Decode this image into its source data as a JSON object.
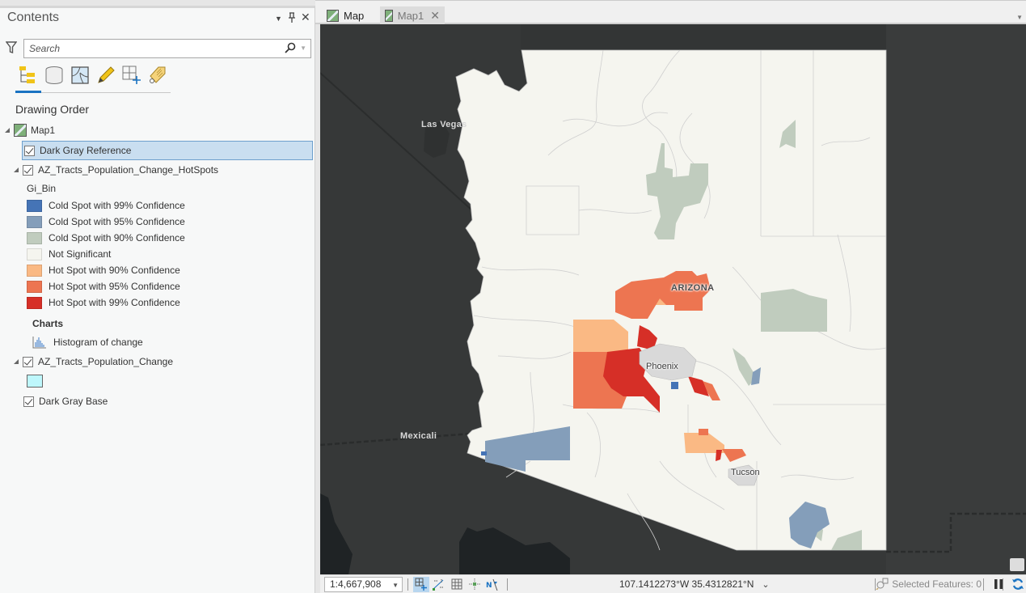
{
  "contents_pane": {
    "title": "Contents",
    "search": {
      "placeholder": "Search",
      "value": ""
    },
    "view_tabs": [
      {
        "name": "list-by-drawing-order",
        "icon": "drawing-order-icon",
        "active": true
      },
      {
        "name": "list-by-data-source",
        "icon": "data-source-icon"
      },
      {
        "name": "list-by-selection",
        "icon": "selection-icon"
      },
      {
        "name": "list-by-editing",
        "icon": "pencil-icon"
      },
      {
        "name": "list-by-snapping",
        "icon": "snapping-icon"
      },
      {
        "name": "list-by-labeling",
        "icon": "label-tag-icon"
      }
    ],
    "heading": "Drawing Order",
    "map_name": "Map1",
    "layers": {
      "reference": {
        "name": "Dark Gray Reference",
        "checked": true,
        "selected": true
      },
      "hotspots": {
        "name": "AZ_Tracts_Population_Change_HotSpots",
        "checked": true,
        "field": "Gi_Bin",
        "classes": [
          {
            "label": "Cold Spot with 99% Confidence",
            "color": "#4574b6"
          },
          {
            "label": "Cold Spot with 95% Confidence",
            "color": "#849eba"
          },
          {
            "label": "Cold Spot with 90% Confidence",
            "color": "#c0ccbe"
          },
          {
            "label": "Not Significant",
            "color": "#f5f5ef"
          },
          {
            "label": "Hot Spot with 90% Confidence",
            "color": "#fab984"
          },
          {
            "label": "Hot Spot with 95% Confidence",
            "color": "#ed7551"
          },
          {
            "label": "Hot Spot with 99% Confidence",
            "color": "#d62f27"
          }
        ],
        "charts_heading": "Charts",
        "chart": "Histogram of change"
      },
      "population_change": {
        "name": "AZ_Tracts_Population_Change",
        "checked": true,
        "color": "#bef7fc"
      },
      "base": {
        "name": "Dark Gray Base",
        "checked": true
      }
    }
  },
  "map_tabs": [
    {
      "label": "Map",
      "active": false
    },
    {
      "label": "Map1",
      "active": true,
      "closable": true
    }
  ],
  "map": {
    "colors": {
      "background": "#363838",
      "land": "#f5f5ef",
      "water_dark": "#1f2325",
      "boundary": "#c8c8c8"
    },
    "labels": {
      "las_vegas": "Las Vegas",
      "mexicali": "Mexicali",
      "arizona": "ARIZONA",
      "phoenix": "Phoenix",
      "tucson": "Tucson"
    }
  },
  "status_bar": {
    "scale": "1:4,667,908",
    "coordinates": "107.1412273°W 35.4312821°N",
    "selected_features": "Selected Features: 0"
  }
}
